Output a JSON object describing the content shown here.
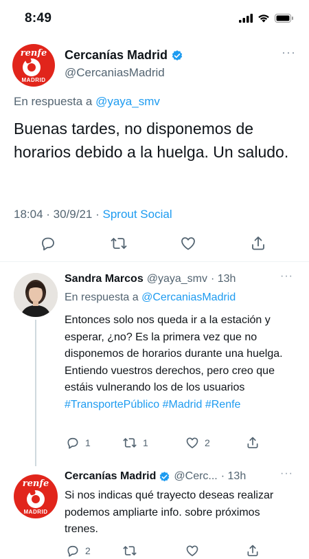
{
  "status_bar": {
    "time": "8:49"
  },
  "main_tweet": {
    "name": "Cercanías Madrid",
    "handle": "@CercaniasMadrid",
    "avatar_logo": "renfe",
    "avatar_label": "MADRID",
    "reply_prefix": "En respuesta a",
    "reply_mention": "@yaya_smv",
    "text": "Buenas tardes, no disponemos de horarios debido a la huelga. Un saludo.",
    "timestamp": "18:04 · 30/9/21 ·",
    "source": "Sprout Social"
  },
  "replies": [
    {
      "name": "Sandra Marcos",
      "handle": "@yaya_smv",
      "time": "· 13h",
      "reply_prefix": "En respuesta a",
      "reply_mention": "@CercaniasMadrid",
      "text": "Entonces solo nos queda ir a la estación y esperar, ¿no? Es la primera vez que no disponemos de horarios durante una huelga. Entiendo vuestros derechos, pero creo que estáis vulnerando los de los usuarios",
      "hashtags": "#TransportePúblico #Madrid #Renfe",
      "reply_count": "1",
      "retweet_count": "1",
      "like_count": "2"
    },
    {
      "name": "Cercanías Madrid",
      "handle": "@Cerc...",
      "time": "· 13h",
      "avatar_logo": "renfe",
      "avatar_label": "MADRID",
      "text": "Si nos indicas qué trayecto deseas realizar podemos ampliarte info. sobre próximos trenes.",
      "reply_count": "2",
      "retweet_count": "",
      "like_count": ""
    }
  ],
  "colors": {
    "accent": "#1d9bf0",
    "renfe_red": "#e1251b",
    "secondary_text": "#536471"
  }
}
